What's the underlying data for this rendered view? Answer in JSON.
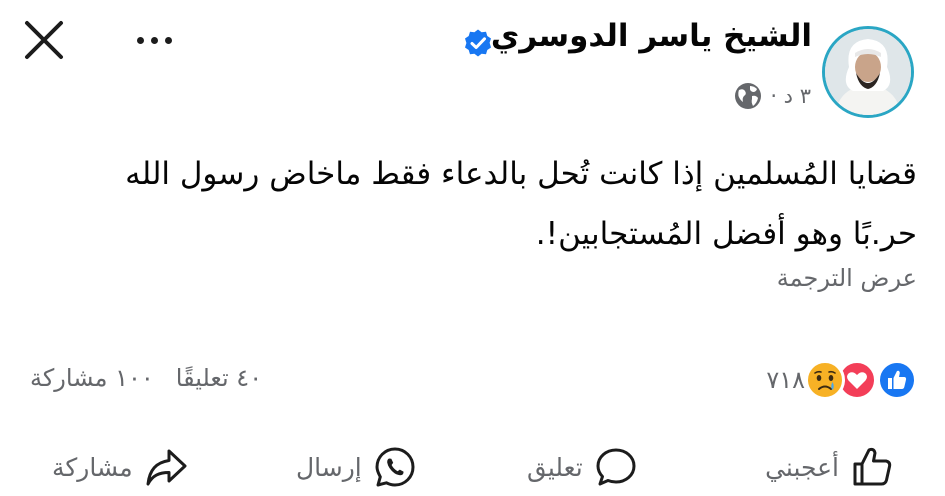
{
  "post": {
    "author": "الشيخ ياسر الدوسري",
    "time": "٣ د ·",
    "text": "قضايا المُسلمين إذا كانت تُحل بالدعاء فقط ماخاض رسول الله\nحر.بًا وهو أفضل المُستجابين!.",
    "see_translation": "عرض الترجمة"
  },
  "stats": {
    "reactions_count": "٧١٨",
    "comments": "٤٠ تعليقًا",
    "shares": "١٠٠ مشاركة"
  },
  "actions": {
    "like": "أعجبني",
    "comment": "تعليق",
    "send": "إرسال",
    "share": "مشاركة"
  },
  "icons": {
    "close": "close-icon",
    "more": "more-icon",
    "verified": "verified-badge-icon",
    "globe": "globe-icon",
    "like_reaction": "like-reaction-icon",
    "love_reaction": "love-reaction-icon",
    "sad_reaction": "sad-reaction-icon"
  },
  "colors": {
    "verified": "#1877f2",
    "like": "#1877f2",
    "love": "#f33e58",
    "sad": "#f7b125",
    "avatar_ring": "#2aa6c4",
    "secondary_text": "#65676b"
  }
}
